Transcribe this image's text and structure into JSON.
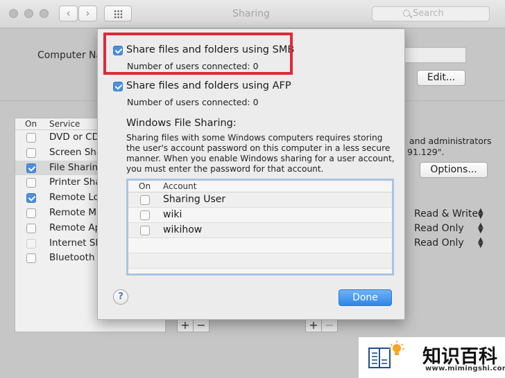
{
  "window": {
    "title": "Sharing",
    "search_placeholder": "Search",
    "back_glyph": "‹",
    "forward_glyph": "›"
  },
  "computer_name_label": "Computer Na",
  "edit_button": "Edit...",
  "options_button": "Options...",
  "services": {
    "col_on": "On",
    "col_service": "Service",
    "items": [
      {
        "label": "DVD or CD",
        "checked": false
      },
      {
        "label": "Screen Sha",
        "checked": false
      },
      {
        "label": "File Sharing",
        "checked": true
      },
      {
        "label": "Printer Sha",
        "checked": false
      },
      {
        "label": "Remote Lo",
        "checked": true
      },
      {
        "label": "Remote Ma",
        "checked": false
      },
      {
        "label": "Remote Ap",
        "checked": false
      },
      {
        "label": "Internet Sh",
        "checked": false
      },
      {
        "label": "Bluetooth S",
        "checked": false
      }
    ]
  },
  "bg_desc_line1": "and administrators",
  "bg_desc_line2": "91.129\".",
  "permissions": [
    "Read & Write",
    "Read Only",
    "Read Only"
  ],
  "plus": "+",
  "minus": "−",
  "sheet": {
    "smb_label": "Share files and folders using SMB",
    "smb_users": "Number of users connected: 0",
    "afp_label": "Share files and folders using AFP",
    "afp_users": "Number of users connected: 0",
    "wfs_title": "Windows File Sharing:",
    "wfs_desc": "Sharing files with some Windows computers requires storing the user's account password on this computer in a less secure manner.  When you enable Windows sharing for a user account, you must enter the password for that account.",
    "table_col_on": "On",
    "table_col_account": "Account",
    "accounts": [
      "Sharing User",
      "wiki",
      "wikihow"
    ],
    "help_label": "?",
    "done_label": "Done"
  },
  "watermark": {
    "cn_text": "知识百科",
    "url": "www.mimingshi.com"
  },
  "colors": {
    "accent": "#4a8fe0",
    "highlight": "#e0283a",
    "done_button": "#2f86e6"
  }
}
